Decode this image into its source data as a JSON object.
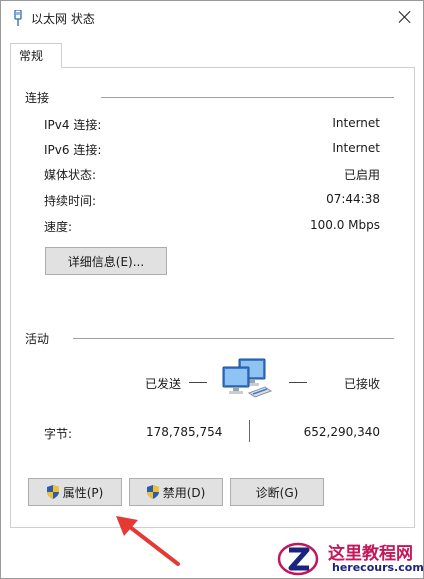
{
  "window": {
    "title": "以太网 状态",
    "close_icon": "close-icon"
  },
  "tabs": [
    {
      "label": "常规",
      "selected": true
    }
  ],
  "connection": {
    "section_title": "连接",
    "rows": [
      {
        "label": "IPv4 连接:",
        "value": "Internet"
      },
      {
        "label": "IPv6 连接:",
        "value": "Internet"
      },
      {
        "label": "媒体状态:",
        "value": "已启用"
      },
      {
        "label": "持续时间:",
        "value": "07:44:38"
      },
      {
        "label": "速度:",
        "value": "100.0 Mbps"
      }
    ],
    "details_button": "详细信息(E)..."
  },
  "activity": {
    "section_title": "活动",
    "sent_label": "已发送",
    "received_label": "已接收",
    "bytes_label": "字节:",
    "bytes_sent": "178,785,754",
    "bytes_received": "652,290,340",
    "icon": "network-computers-icon"
  },
  "buttons": {
    "properties": "属性(P)",
    "disable": "禁用(D)",
    "diagnose": "诊断(G)"
  },
  "watermark": {
    "title": "这里教程网",
    "url": "herecours.com"
  },
  "colors": {
    "annotation_arrow": "#e53935",
    "watermark_red": "#c2185b",
    "watermark_blue": "#1a237e",
    "button_face": "#e1e1e1"
  }
}
